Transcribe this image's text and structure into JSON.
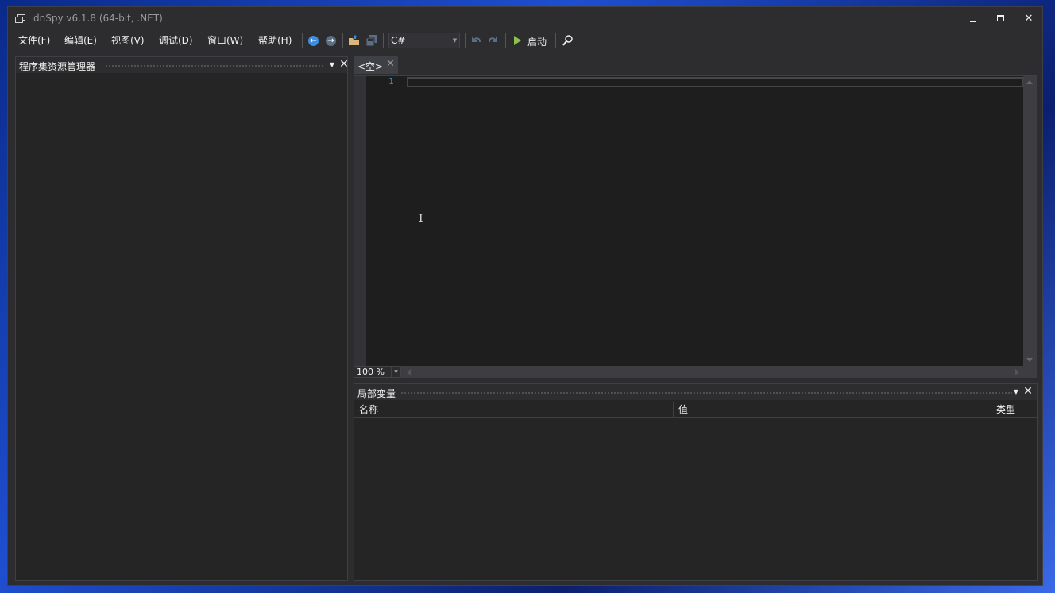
{
  "window": {
    "title": "dnSpy v6.1.8 (64-bit, .NET)"
  },
  "menu": {
    "items": [
      {
        "label": "文件(F)"
      },
      {
        "label": "编辑(E)"
      },
      {
        "label": "视图(V)"
      },
      {
        "label": "调试(D)"
      },
      {
        "label": "窗口(W)"
      },
      {
        "label": "帮助(H)"
      }
    ]
  },
  "toolbar": {
    "language": "C#",
    "start_label": "启动",
    "back_glyph": "←",
    "forward_glyph": "→"
  },
  "assembly_explorer": {
    "title": "程序集资源管理器"
  },
  "editor": {
    "tab_label": "<空>",
    "line_number": "1",
    "zoom": "100 %",
    "cursor_glyph": "I"
  },
  "locals": {
    "title": "局部变量",
    "columns": [
      {
        "label": "名称"
      },
      {
        "label": "值"
      },
      {
        "label": "类型"
      }
    ]
  },
  "colors": {
    "background": "#2d2d30",
    "panel": "#252526",
    "editor": "#1e1e1e",
    "accent": "#3c8ee0",
    "line_number": "#2b91af"
  }
}
